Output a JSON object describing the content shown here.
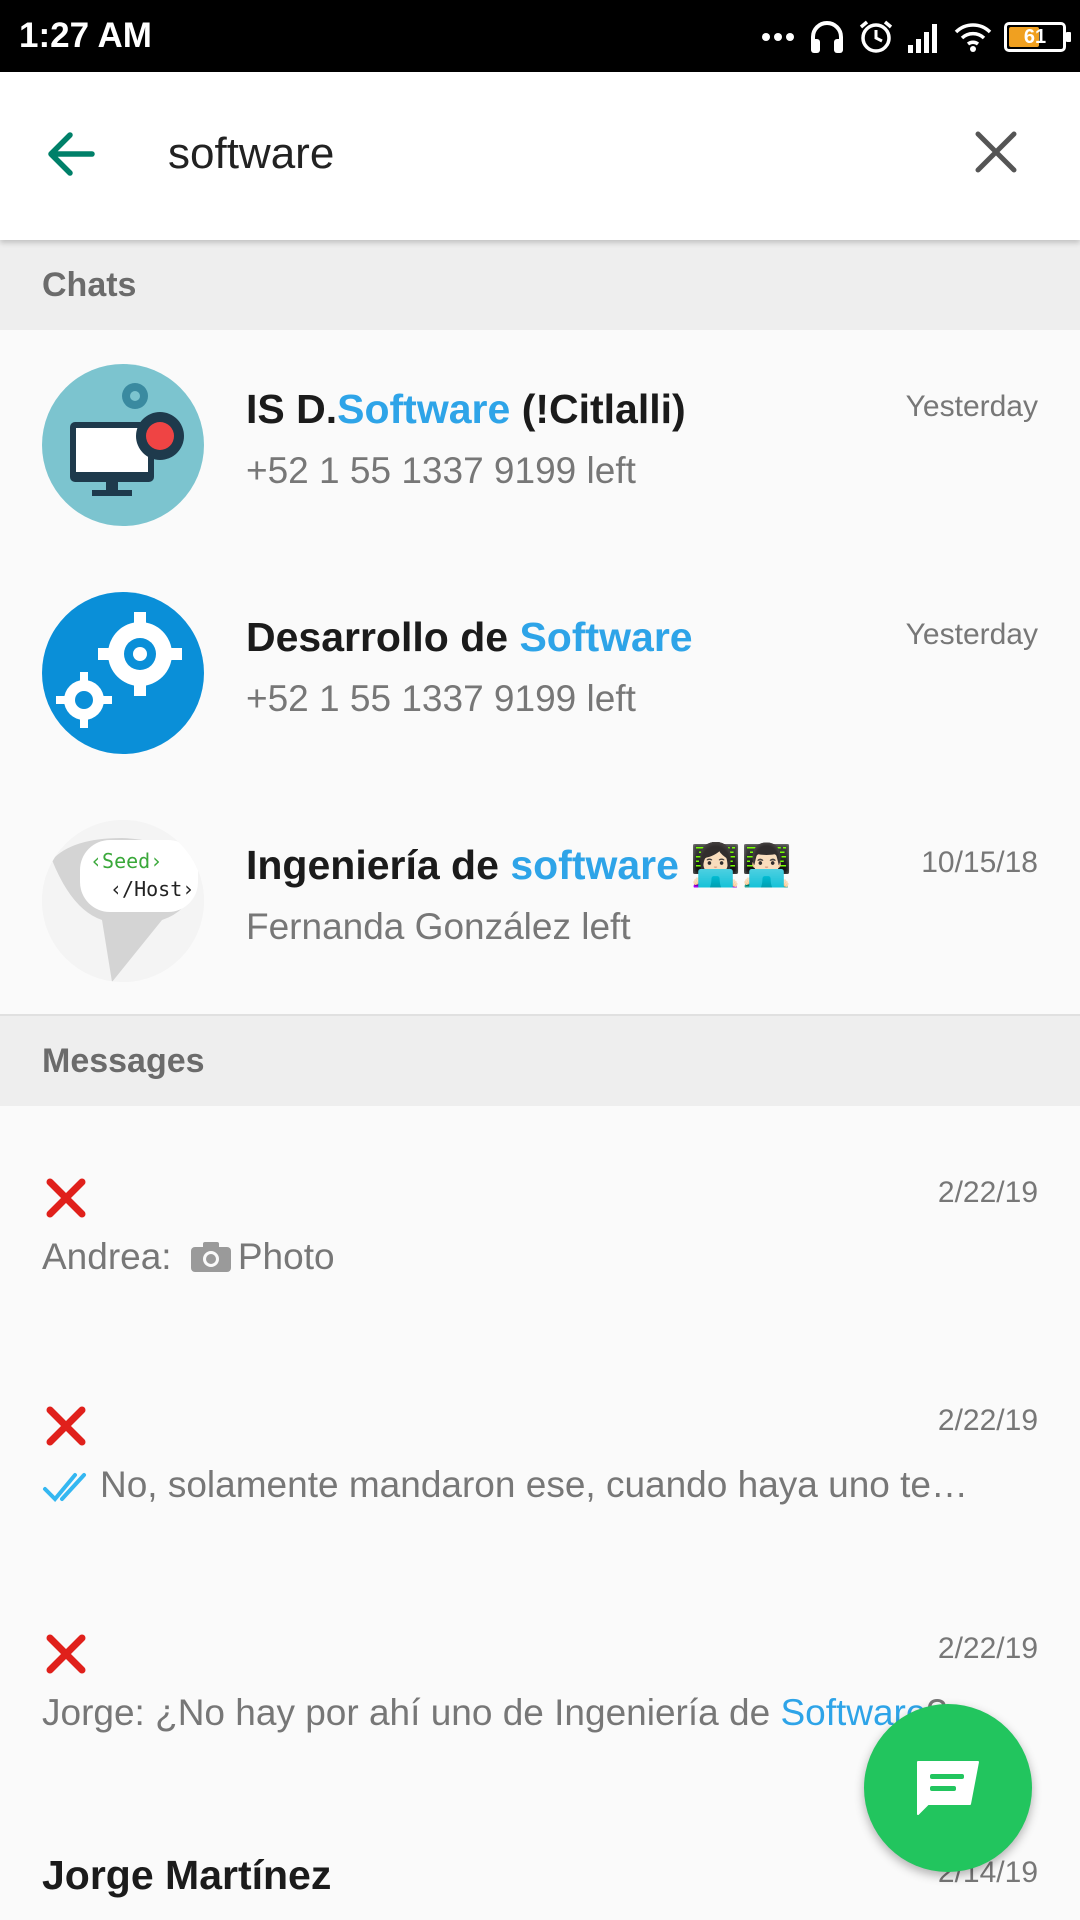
{
  "status_bar": {
    "time": "1:27 AM",
    "battery_level": "61",
    "icons": [
      "more-dots-icon",
      "headphones-icon",
      "alarm-icon",
      "signal-icon",
      "wifi-icon",
      "battery-icon"
    ]
  },
  "search": {
    "value": "software",
    "back_icon": "arrow-left-icon",
    "clear_icon": "close-icon"
  },
  "sections": {
    "chats_label": "Chats",
    "messages_label": "Messages"
  },
  "chats": [
    {
      "name_before": "IS D.",
      "name_highlight": "Software",
      "name_after": " (!Citlalli)",
      "subtitle": "+52 1 55 1337 9199 left",
      "time": "Yesterday",
      "avatar_icon": "monitor-gear-icon"
    },
    {
      "name_before": "Desarrollo de ",
      "name_highlight": "Software",
      "name_after": "",
      "subtitle": "+52 1 55 1337 9199 left",
      "time": "Yesterday",
      "avatar_icon": "gears-icon"
    },
    {
      "name_before": "Ingeniería de ",
      "name_highlight": "software",
      "name_after": " 👩🏻‍💻👨🏻‍💻",
      "subtitle": "Fernanda González left",
      "time": "10/15/18",
      "avatar_icon": "seed-host-logo",
      "avatar_text_1": "‹Seed›",
      "avatar_text_2": "‹/Host›"
    }
  ],
  "messages": [
    {
      "icon": "red-x-icon",
      "time": "2/22/19",
      "sender": "Andrea: ",
      "text": "Photo",
      "highlight": "",
      "text_after": ""
    },
    {
      "icon": "red-x-icon",
      "time": "2/22/19",
      "sender": "",
      "text": "No, solamente mandaron ese, cuando haya uno te…",
      "highlight": "",
      "text_after": ""
    },
    {
      "icon": "red-x-icon",
      "time": "2/22/19",
      "sender": "",
      "text": "Jorge: ¿No hay por ahí uno de Ingeniería de ",
      "highlight": "Software",
      "text_after": "?"
    }
  ],
  "contact": {
    "name": "Jorge Martínez",
    "time": "2/14/19"
  },
  "fab": {
    "icon": "new-chat-icon"
  },
  "colors": {
    "accent": "#008069",
    "highlight": "#2ea4e8",
    "fab": "#22c55e",
    "red_x": "#e0201b"
  }
}
